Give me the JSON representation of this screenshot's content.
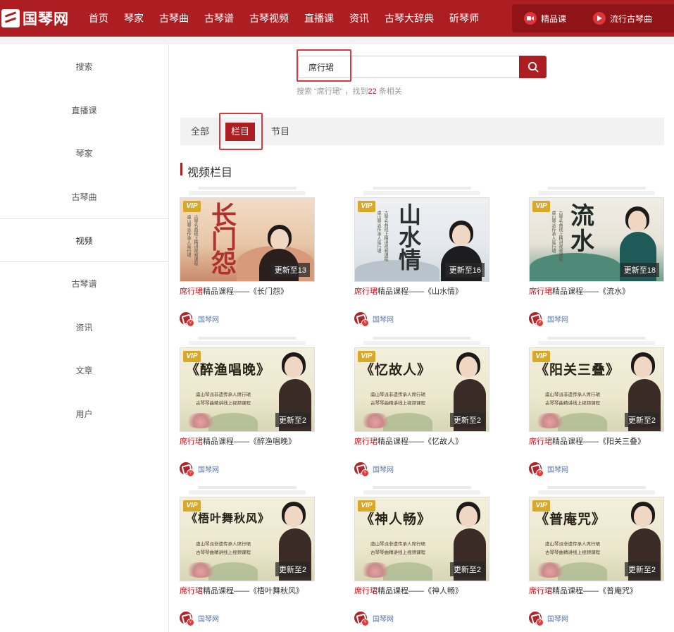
{
  "brand": {
    "logo_text": "国琴网"
  },
  "nav": {
    "items": [
      "首页",
      "琴家",
      "古琴曲",
      "古琴谱",
      "古琴视频",
      "直播课",
      "资讯",
      "古琴大辞典",
      "斫琴师"
    ],
    "right": [
      {
        "label": "精品课",
        "icon": "video-camera-icon"
      },
      {
        "label": "流行古琴曲",
        "icon": "play-icon"
      }
    ]
  },
  "sidebar": {
    "items": [
      "搜索",
      "直播课",
      "琴家",
      "古琴曲",
      "视频",
      "古琴谱",
      "资讯",
      "文章",
      "用户"
    ],
    "active": "视频"
  },
  "search": {
    "value": "席行珺",
    "placeholder": "",
    "button_icon": "search-icon",
    "result_prefix": "搜索 “席行珺” ，找到",
    "result_count": "22",
    "result_suffix": " 条相关"
  },
  "tabs": {
    "items": [
      "全部",
      "栏目",
      "节目"
    ],
    "active": "栏目"
  },
  "section": {
    "title": "视频栏目"
  },
  "colors": {
    "brand": "#ad1e22",
    "nav_dark": "#8e1418",
    "highlight": "#d0111a",
    "author_link": "#5a76a8",
    "vip": "#d7a829"
  },
  "cards": [
    {
      "badge": "VIP",
      "art_text": "长门怨",
      "update": "更新至13",
      "title_highlight": "席行珺",
      "title_rest": "精品课程——《长门怨》",
      "author": "国琴网"
    },
    {
      "badge": "VIP",
      "art_text": "山水情",
      "update": "更新至16",
      "title_highlight": "席行珺",
      "title_rest": "精品课程——《山水情》",
      "author": "国琴网"
    },
    {
      "badge": "VIP",
      "art_text": "流水",
      "update": "更新至18",
      "title_highlight": "席行珺",
      "title_rest": "精品课程——《流水》",
      "author": "国琴网"
    },
    {
      "badge": "VIP",
      "art_text": "《醉渔唱晚》",
      "update": "更新至2",
      "title_highlight": "席行珺",
      "title_rest": "精品课程——《醉渔唱晚》",
      "author": "国琴网"
    },
    {
      "badge": "VIP",
      "art_text": "《忆故人》",
      "update": "更新至2",
      "title_highlight": "席行珺",
      "title_rest": "精品课程——《忆故人》",
      "author": "国琴网"
    },
    {
      "badge": "VIP",
      "art_text": "《阳关三叠》",
      "update": "更新至2",
      "title_highlight": "席行珺",
      "title_rest": "精品课程——《阳关三叠》",
      "author": "国琴网"
    },
    {
      "badge": "VIP",
      "art_text": "《梧叶舞秋风》",
      "update": "更新至2",
      "title_highlight": "席行珺",
      "title_rest": "精品课程——《梧叶舞秋风》",
      "author": "国琴网"
    },
    {
      "badge": "VIP",
      "art_text": "《神人畅》",
      "update": "更新至2",
      "title_highlight": "席行珺",
      "title_rest": "精品课程——《神人畅》",
      "author": "国琴网"
    },
    {
      "badge": "VIP",
      "art_text": "《普庵咒》",
      "update": "更新至2",
      "title_highlight": "席行珺",
      "title_rest": "精品课程——《普庵咒》",
      "author": "国琴网"
    }
  ],
  "poster_text": {
    "subtitle_line1": "虞山琴派非遗传承人席行珺",
    "subtitle_line2": "古琴琴曲精讲线上视频课程",
    "vertical_1": "虞山琴派传承人席行珺",
    "vertical_2": "古琴名曲线上精讲视频课程"
  }
}
